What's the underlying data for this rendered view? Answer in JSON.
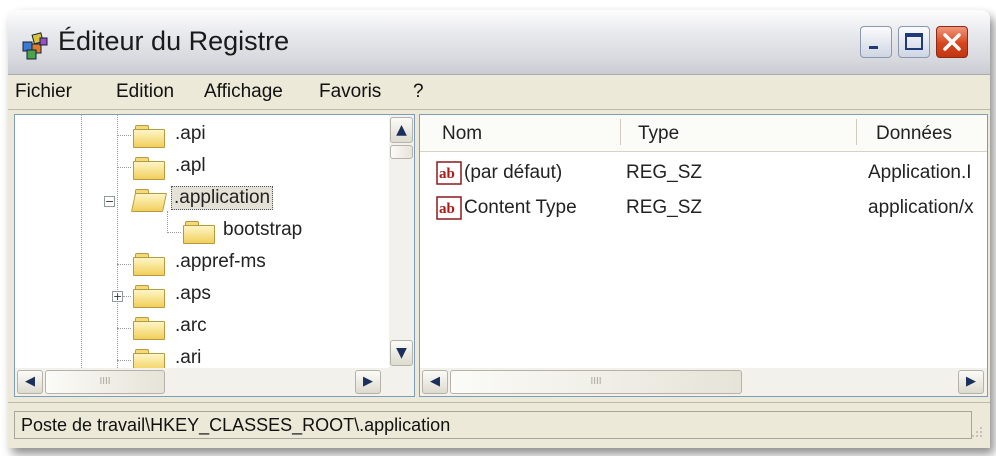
{
  "window": {
    "title": "Éditeur du Registre"
  },
  "menu": {
    "items": [
      "Fichier",
      "Edition",
      "Affichage",
      "Favoris",
      "?"
    ]
  },
  "tree": {
    "items": [
      {
        "label": ".api"
      },
      {
        "label": ".apl"
      },
      {
        "label": ".application",
        "expanded": true,
        "selected": true
      },
      {
        "label": "bootstrap"
      },
      {
        "label": ".appref-ms"
      },
      {
        "label": ".aps",
        "expandable": true
      },
      {
        "label": ".arc"
      },
      {
        "label": ".ari"
      }
    ]
  },
  "list": {
    "columns": [
      "Nom",
      "Type",
      "Données"
    ],
    "rows": [
      {
        "icon": "ab",
        "name": "(par défaut)",
        "type": "REG_SZ",
        "data": "Application.I"
      },
      {
        "icon": "ab",
        "name": "Content Type",
        "type": "REG_SZ",
        "data": "application/x"
      }
    ]
  },
  "scroll": {
    "grip": "IIII"
  },
  "status": {
    "path": "Poste de travail\\HKEY_CLASSES_ROOT\\.application"
  },
  "colors": {
    "window_bg": "#ECE9D8",
    "close_button": "#D6451D",
    "pane_border": "#7F9DB9",
    "folder": "#F1CF5C"
  },
  "icons": {
    "app": "registry-editor-icon",
    "folder": "folder-icon",
    "value": "string-value-icon"
  }
}
